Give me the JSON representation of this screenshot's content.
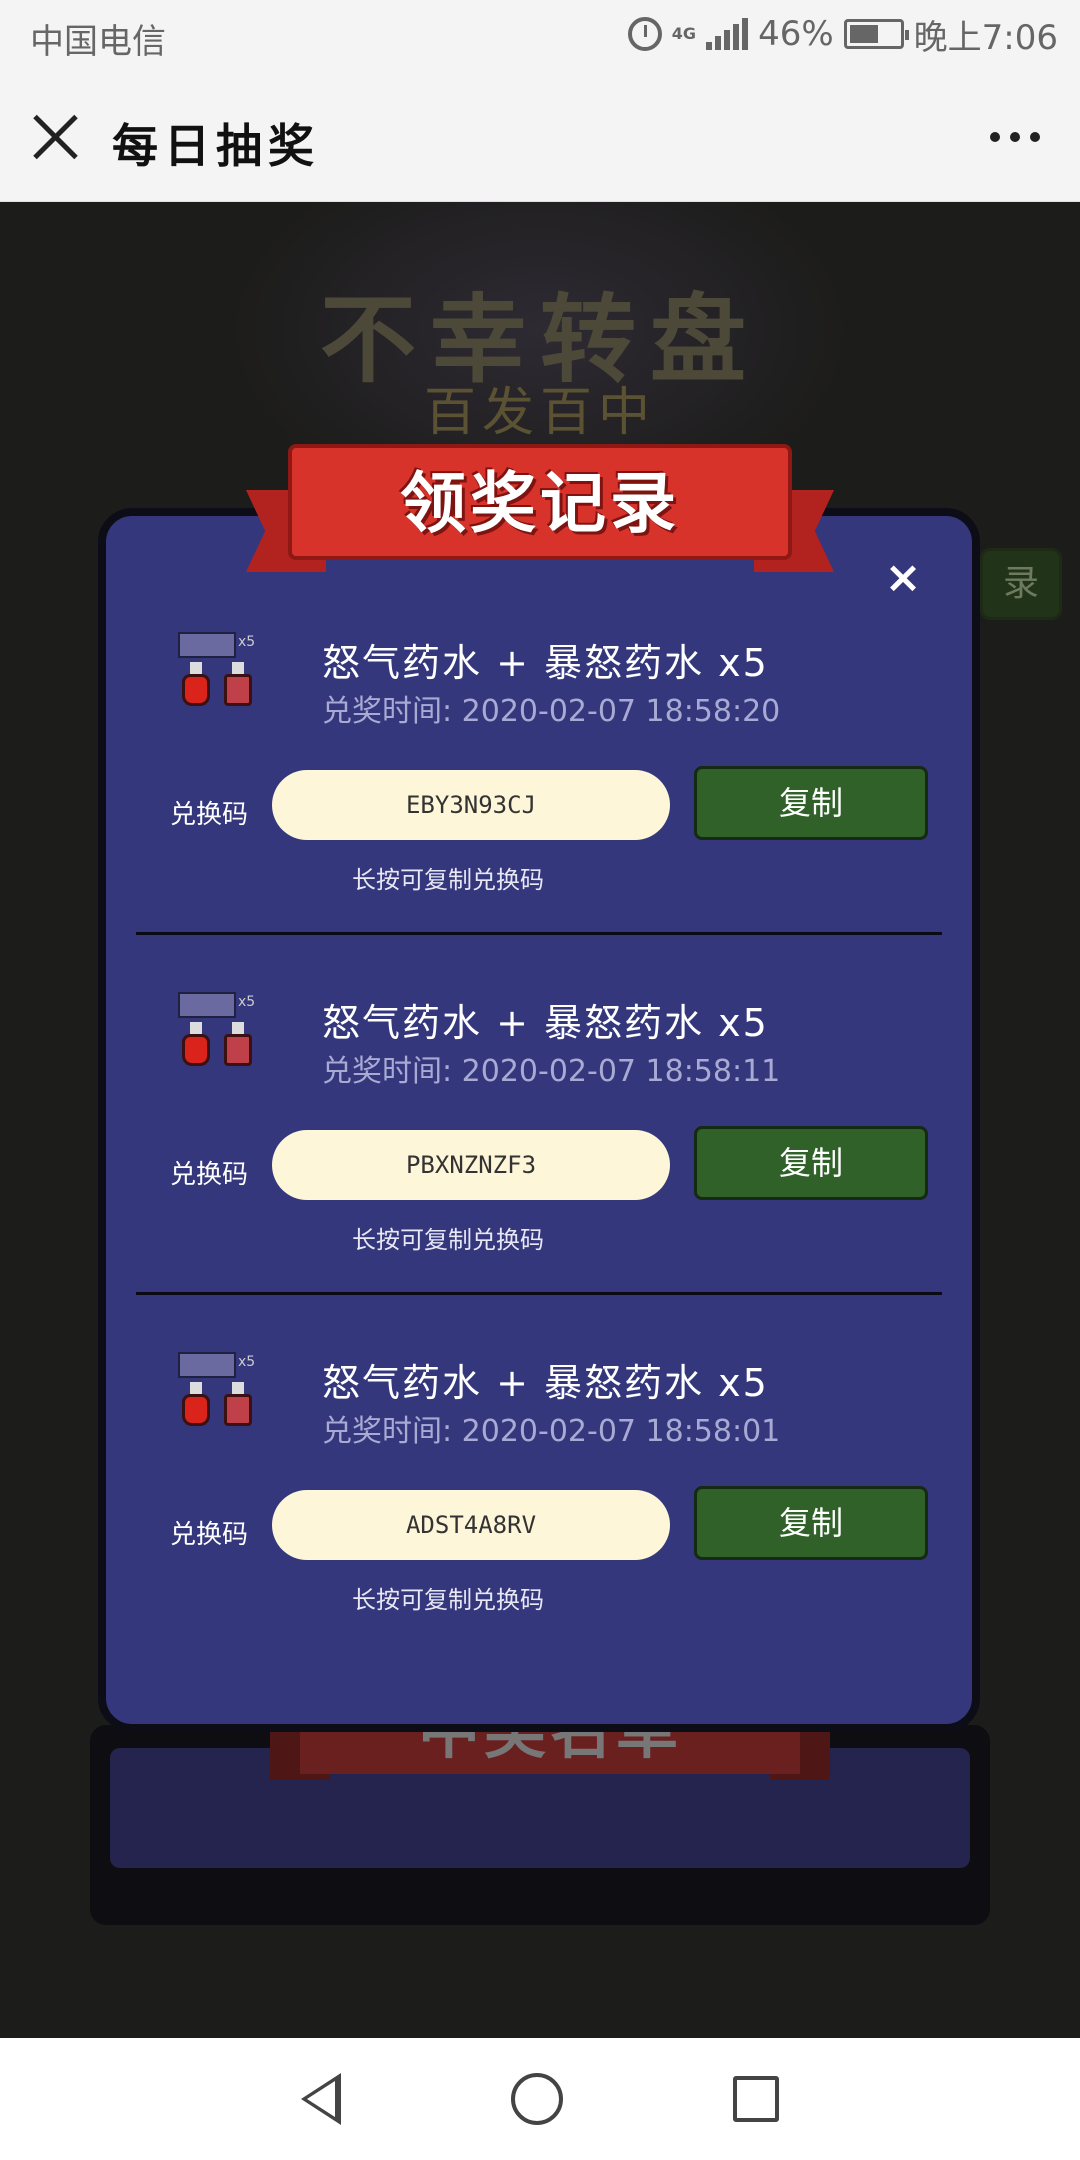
{
  "status_bar": {
    "carrier": "中国电信",
    "network": "4G",
    "battery": "46%",
    "time": "晚上7:06"
  },
  "header": {
    "title": "每日抽奖"
  },
  "background": {
    "title": "不幸转盘",
    "subtitle": "百发百中",
    "side_button": "录",
    "bottom_banner": "中奖名单"
  },
  "modal": {
    "title": "领奖记录",
    "close": "×",
    "records": [
      {
        "prize": "怒气药水 + 暴怒药水 x5",
        "time": "兑奖时间: 2020-02-07 18:58:20",
        "code_label": "兑换码",
        "code": "EBY3N93CJ",
        "copy_label": "复制",
        "hint": "长按可复制兑换码"
      },
      {
        "prize": "怒气药水 + 暴怒药水 x5",
        "time": "兑奖时间: 2020-02-07 18:58:11",
        "code_label": "兑换码",
        "code": "PBXNZNZF3",
        "copy_label": "复制",
        "hint": "长按可复制兑换码"
      },
      {
        "prize": "怒气药水 + 暴怒药水 x5",
        "time": "兑奖时间: 2020-02-07 18:58:01",
        "code_label": "兑换码",
        "code": "ADST4A8RV",
        "copy_label": "复制",
        "hint": "长按可复制兑换码"
      }
    ]
  }
}
